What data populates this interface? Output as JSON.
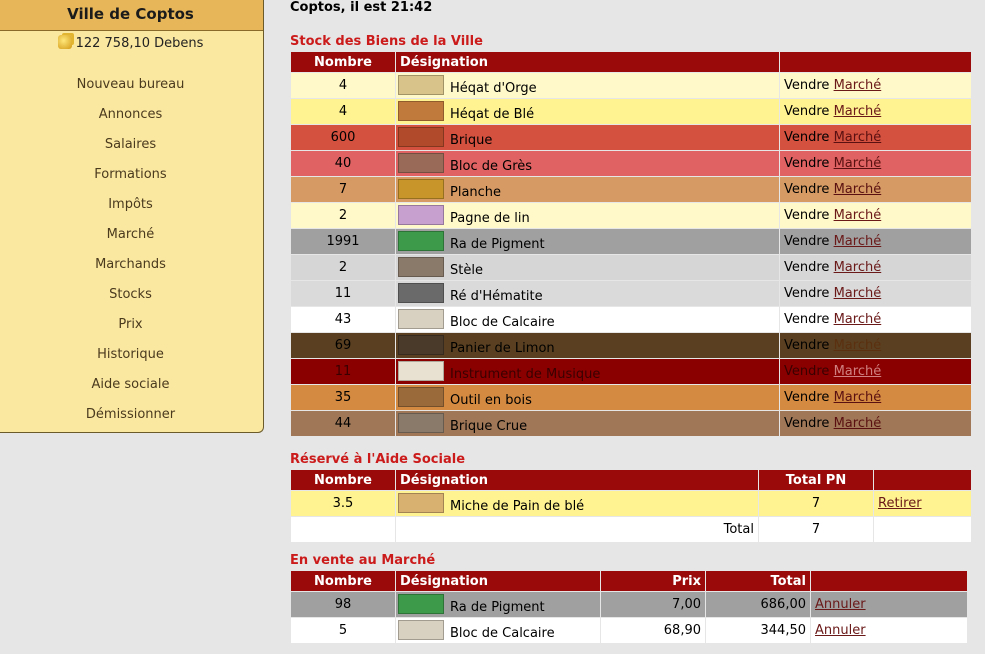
{
  "sidebar": {
    "title": "Ville de Coptos",
    "money": "122 758,10 Debens",
    "menu": [
      "Nouveau bureau",
      "Annonces",
      "Salaires",
      "Formations",
      "Impôts",
      "Marché",
      "Marchands",
      "Stocks",
      "Prix",
      "Historique",
      "Aide sociale",
      "Démissionner"
    ]
  },
  "header": {
    "clock": "Coptos, il est 21:42"
  },
  "stock": {
    "title": "Stock des Biens de la Ville",
    "headers": [
      "Nombre",
      "Désignation",
      ""
    ],
    "sell_label": "Vendre",
    "market_label": "Marché",
    "rows": [
      {
        "n": "4",
        "name": "Héqat d'Orge",
        "bg": "#fff8c8",
        "fg": "#000",
        "link": "#6a1818",
        "thumb": "#d8c48a",
        "icon": "barley-bag-icon"
      },
      {
        "n": "4",
        "name": "Héqat de Blé",
        "bg": "#fff391",
        "fg": "#000",
        "link": "#6a1818",
        "thumb": "#c07a3c",
        "icon": "wheat-grain-icon"
      },
      {
        "n": "600",
        "name": "Brique",
        "bg": "#d4503f",
        "fg": "#000",
        "link": "#5a1010",
        "thumb": "#b04a2a",
        "icon": "brick-icon"
      },
      {
        "n": "40",
        "name": "Bloc de Grès",
        "bg": "#e06262",
        "fg": "#000",
        "link": "#5a1010",
        "thumb": "#9a6a58",
        "icon": "sandstone-block-icon"
      },
      {
        "n": "7",
        "name": "Planche",
        "bg": "#d69a64",
        "fg": "#000",
        "link": "#5a1010",
        "thumb": "#c8952a",
        "icon": "plank-icon"
      },
      {
        "n": "2",
        "name": "Pagne de lin",
        "bg": "#fff8c8",
        "fg": "#000",
        "link": "#6a1818",
        "thumb": "#c8a0d0",
        "icon": "linen-cloth-icon"
      },
      {
        "n": "1991",
        "name": "Ra de Pigment",
        "bg": "#a0a0a0",
        "fg": "#000",
        "link": "#6a1818",
        "thumb": "#3c9a4a",
        "icon": "pigment-bowl-icon"
      },
      {
        "n": "2",
        "name": "Stèle",
        "bg": "#d6d6d6",
        "fg": "#000",
        "link": "#6a1818",
        "thumb": "#8a7a6a",
        "icon": "stele-icon"
      },
      {
        "n": "11",
        "name": "Ré d'Hématite",
        "bg": "#dadada",
        "fg": "#000",
        "link": "#6a1818",
        "thumb": "#6a6a6a",
        "icon": "hematite-icon"
      },
      {
        "n": "43",
        "name": "Bloc de Calcaire",
        "bg": "#ffffff",
        "fg": "#000",
        "link": "#6a1818",
        "thumb": "#d8d0c0",
        "icon": "limestone-block-icon"
      },
      {
        "n": "69",
        "name": "Panier de Limon",
        "bg": "#5a4020",
        "fg": "#000",
        "link": "#5a3010",
        "thumb": "#4a3a2a",
        "icon": "silt-basket-icon"
      },
      {
        "n": "11",
        "name": "Instrument de Musique",
        "bg": "#8a0000",
        "fg": "#3a0000",
        "link": "#d08080",
        "thumb": "#e8e0d0",
        "icon": "flute-icon"
      },
      {
        "n": "35",
        "name": "Outil en bois",
        "bg": "#d48a40",
        "fg": "#000",
        "link": "#5a1010",
        "thumb": "#9a6a3a",
        "icon": "wooden-tool-icon"
      },
      {
        "n": "44",
        "name": "Brique Crue",
        "bg": "#a07858",
        "fg": "#000",
        "link": "#5a1010",
        "thumb": "#8a7a6a",
        "icon": "mud-brick-icon"
      }
    ]
  },
  "social": {
    "title": "Réservé à l'Aide Sociale",
    "headers": [
      "Nombre",
      "Désignation",
      "Total PN",
      ""
    ],
    "rows": [
      {
        "n": "3.5",
        "name": "Miche de Pain de blé",
        "total": "7",
        "action": "Retirer",
        "bg": "#fff391",
        "thumb": "#d8b070",
        "icon": "bread-loaf-icon"
      }
    ],
    "total_label": "Total",
    "total_value": "7"
  },
  "market": {
    "title": "En vente au Marché",
    "headers": [
      "Nombre",
      "Désignation",
      "Prix",
      "Total",
      ""
    ],
    "rows": [
      {
        "n": "98",
        "name": "Ra de Pigment",
        "price": "7,00",
        "total": "686,00",
        "action": "Annuler",
        "bg": "#a0a0a0",
        "thumb": "#3c9a4a",
        "icon": "pigment-bowl-icon"
      },
      {
        "n": "5",
        "name": "Bloc de Calcaire",
        "price": "68,90",
        "total": "344,50",
        "action": "Annuler",
        "bg": "#ffffff",
        "thumb": "#d8d0c0",
        "icon": "limestone-block-icon"
      }
    ]
  }
}
